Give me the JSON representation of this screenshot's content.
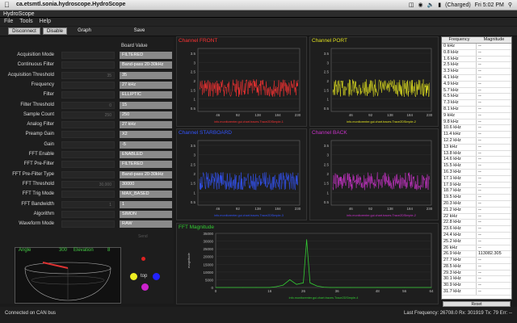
{
  "os_menubar": {
    "app_name": "ca.etsmtl.sonia.hydroscope.HydroScope",
    "clock": "Fri 5:02 PM",
    "battery": "(Charged)"
  },
  "window": {
    "title": "HydroScope"
  },
  "menu": [
    "File",
    "Tools",
    "Help"
  ],
  "toolbar": {
    "disconnect": "Disconnect",
    "disable": "Disable",
    "graph": "Graph",
    "save": "Save"
  },
  "params": {
    "header": "Board Value",
    "rows": [
      {
        "label": "Acquisition Mode",
        "input": "",
        "value": "FILTERED"
      },
      {
        "label": "Continuous Filter",
        "input": "",
        "value": "Band-pass 20-30kHz"
      },
      {
        "label": "Acquisition Threshold",
        "input": "35",
        "value": "35"
      },
      {
        "label": "Frequency",
        "input": "",
        "value": "27 kHz"
      },
      {
        "label": "Filter",
        "input": "",
        "value": "ELLIPTIC"
      },
      {
        "label": "Filter Threshold",
        "input": "0",
        "value": "15"
      },
      {
        "label": "Sample Count",
        "input": "250",
        "value": "250"
      },
      {
        "label": "Analog Filter",
        "input": "",
        "value": "27 kHz"
      },
      {
        "label": "Preamp Gain",
        "input": "",
        "value": "X2"
      },
      {
        "label": "Gain",
        "input": "",
        "value": "-5"
      },
      {
        "label": "FFT Enable",
        "input": "",
        "value": "ENABLED"
      },
      {
        "label": "FFT Pre-Filter",
        "input": "",
        "value": "FILTERED"
      },
      {
        "label": "FFT Pre-Filter Type",
        "input": "",
        "value": "Band-pass 20-30kHz"
      },
      {
        "label": "FFT Threshold",
        "input": "30,000",
        "value": "30000"
      },
      {
        "label": "FFT Trig Mode",
        "input": "",
        "value": "MAX_BASED"
      },
      {
        "label": "FFT Bandwidth",
        "input": "1",
        "value": "1"
      },
      {
        "label": "Algorithm",
        "input": "",
        "value": "SIMON"
      },
      {
        "label": "Waveform Mode",
        "input": "",
        "value": "RAW"
      }
    ],
    "send": "Send"
  },
  "angle": {
    "label": "Angle",
    "angle_value": "300",
    "elevation_label": "Elevation",
    "elevation_value": "8"
  },
  "dots": {
    "top_label": "top"
  },
  "charts": {
    "front": {
      "title": "Channel FRONT",
      "color": "#ff3333",
      "footer": "info.monitorenter.gui.chart.traces.Trace2DSimple-1",
      "yticks": [
        "3.5",
        "3",
        "2.5",
        "2",
        "1.5",
        "1",
        "0.5"
      ],
      "xticks": [
        "46",
        "92",
        "138",
        "184",
        "230"
      ]
    },
    "port": {
      "title": "Channel PORT",
      "color": "#e0e020",
      "footer": "info.monitorenter.gui.chart.traces.Trace2DSimple-2",
      "yticks": [
        "3.5",
        "3",
        "2.5",
        "2",
        "1.5",
        "1",
        "0.5"
      ],
      "xticks": [
        "46",
        "92",
        "138",
        "184",
        "230"
      ]
    },
    "starboard": {
      "title": "Channel STARBOARD",
      "color": "#3355ff",
      "footer": "info.monitorenter.gui.chart.traces.Trace2DSimple-3",
      "yticks": [
        "3.5",
        "3",
        "2.5",
        "2",
        "1.5",
        "1",
        "0.5"
      ],
      "xticks": [
        "46",
        "92",
        "138",
        "184",
        "230"
      ]
    },
    "back": {
      "title": "Channel BACK",
      "color": "#cc33cc",
      "footer": "info.monitorenter.gui.chart.traces.Trace2DSimple-2",
      "yticks": [
        "3.5",
        "3",
        "2.5",
        "2",
        "1.5",
        "1",
        "0.5"
      ],
      "xticks": [
        "46",
        "92",
        "138",
        "184",
        "230"
      ]
    },
    "fft": {
      "title": "FFT Magnitude",
      "color": "#33cc33",
      "footer": "info.monitorenter.gui.chart.traces.Trace2DSimple-4",
      "ylabel": "magnitude",
      "yticks": [
        "35000",
        "30000",
        "25000",
        "20000",
        "15000",
        "10000",
        "5000",
        "0"
      ],
      "xticks": [
        "0",
        "16",
        "26",
        "36",
        "48",
        "56",
        "64"
      ]
    }
  },
  "chart_data": {
    "type": "line",
    "title": "FFT Magnitude",
    "ylabel": "magnitude",
    "x": [
      0,
      4,
      8,
      12,
      16,
      18,
      20,
      22,
      24,
      26,
      27,
      28,
      30,
      32,
      34,
      36,
      40,
      48,
      56,
      64
    ],
    "values": [
      0,
      0,
      0,
      0,
      0,
      500,
      1500,
      5000,
      2000,
      3000,
      31000,
      3000,
      1000,
      200,
      0,
      0,
      0,
      0,
      0,
      0
    ],
    "ylim": [
      0,
      35000
    ]
  },
  "freq": {
    "headers": [
      "Frequency",
      "Magnitude"
    ],
    "rows": [
      [
        "0 kHz",
        "--"
      ],
      [
        "0.8 kHz",
        "--"
      ],
      [
        "1.6 kHz",
        "--"
      ],
      [
        "2.5 kHz",
        "--"
      ],
      [
        "3.3 kHz",
        "--"
      ],
      [
        "4.1 kHz",
        "--"
      ],
      [
        "4.9 kHz",
        "--"
      ],
      [
        "5.7 kHz",
        "--"
      ],
      [
        "6.5 kHz",
        "--"
      ],
      [
        "7.3 kHz",
        "--"
      ],
      [
        "8.1 kHz",
        "--"
      ],
      [
        "9 kHz",
        "--"
      ],
      [
        "9.8 kHz",
        "--"
      ],
      [
        "10.6 kHz",
        "--"
      ],
      [
        "11.4 kHz",
        "--"
      ],
      [
        "12.2 kHz",
        "--"
      ],
      [
        "13 kHz",
        "--"
      ],
      [
        "13.8 kHz",
        "--"
      ],
      [
        "14.6 kHz",
        "--"
      ],
      [
        "15.5 kHz",
        "--"
      ],
      [
        "16.3 kHz",
        "--"
      ],
      [
        "17.1 kHz",
        "--"
      ],
      [
        "17.9 kHz",
        "--"
      ],
      [
        "18.7 kHz",
        "--"
      ],
      [
        "19.5 kHz",
        "--"
      ],
      [
        "20.3 kHz",
        "--"
      ],
      [
        "21.2 kHz",
        "--"
      ],
      [
        "22 kHz",
        "--"
      ],
      [
        "22.8 kHz",
        "--"
      ],
      [
        "23.6 kHz",
        "--"
      ],
      [
        "24.4 kHz",
        "--"
      ],
      [
        "25.2 kHz",
        "--"
      ],
      [
        "26 kHz",
        "--"
      ],
      [
        "26.9 kHz",
        "113082.305"
      ],
      [
        "27.7 kHz",
        "--"
      ],
      [
        "28.5 kHz",
        "--"
      ],
      [
        "29.3 kHz",
        "--"
      ],
      [
        "30.1 kHz",
        "--"
      ],
      [
        "30.9 kHz",
        "--"
      ],
      [
        "31.7 kHz",
        "--"
      ]
    ],
    "reset": "Reset"
  },
  "status": {
    "left": "Connected on CAN bus",
    "right": "Last Frequency: 26708.0 Rx: 301919 Tx: 79 Err: --"
  }
}
